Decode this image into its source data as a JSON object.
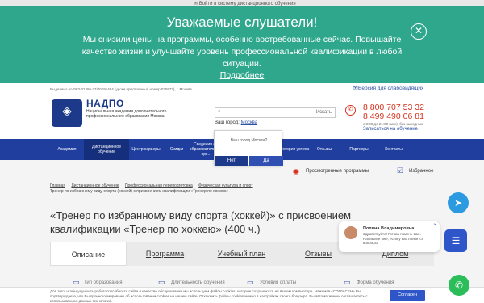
{
  "topbar": {
    "login_text": "✉ Войти в систему дистанционного обучения"
  },
  "banner": {
    "title": "Уважаемые слушатели!",
    "text": "Мы снизили цены на программы, особенно востребованные сейчас. Повышайте качество жизни и улучшайте уровень профессиональной квалификации в любой ситуации.",
    "more_link": "Подробнее",
    "close_icon": "✕"
  },
  "header": {
    "infoline": "Выделено по ЛКЗ-01286-77/00191484 (уроки присвоенный номер 035972), г. Москва",
    "vision_label": "Версия для слабовидящих",
    "logo_text": "◈",
    "brand": "НАДПО",
    "brand_sub": "Национальная академия дополнительного профессионального образования Москва",
    "search_button": "Искать",
    "city_label": "Ваш город:",
    "city_value": "Москва",
    "phone1": "8 800 707 53 32",
    "phone2": "8 499 490 06 81",
    "hours": "с 8:00 до 21:00 (мск), без выходных",
    "signup": "Записаться на обучение"
  },
  "nav": {
    "items": [
      "Академия",
      "Дистанционное обучение",
      "Центр карьеры",
      "Скидки",
      "Сведения об образовательной орг...",
      "",
      "",
      "История успеха",
      "Отзывы",
      "Партнеры",
      "Контакты"
    ]
  },
  "city_popup": {
    "question": "Ваш город Москва?",
    "no": "Нет",
    "yes": "Да"
  },
  "tools": {
    "viewed": "Просмотренные программы",
    "favorites": "Избранное"
  },
  "breadcrumbs": [
    "Главная",
    "Дистанционное обучение",
    "Профессиональная переподготовка",
    "Физическая культура и спорт",
    "Тренер по избранному виду спорта (хоккей) с присвоением квалификации «Тренер по хоккею»"
  ],
  "course": {
    "title": "«Тренер по избранному виду спорта (хоккей)» с присвоением квалификации «Тренер по хоккею» (400 ч.)"
  },
  "tabs": [
    "Описание",
    "Программа",
    "Учебный план",
    "Отзывы",
    "Диплом"
  ],
  "features": [
    "Тип образования",
    "Длительность обучения",
    "Условия оплаты",
    "Форма обучения"
  ],
  "cookie": {
    "text": "Для того, чтобы улучшить работоспособность сайта и качество обслуживания мы используем файлы cookies, которые сохраняются на вашем компьютере. Нажимая «СОГЛАСЕН» Вы подтверждаете, что Вы проинформированы об использовании cookies на нашем сайте. Отключить файлы cookies можно в настройках своего браузера. Вы автоматически соглашаетесь с использованием данных технологий.",
    "button": "Согласен"
  },
  "chat": {
    "name": "Полина Владимировна",
    "message": "Здравствуйте! Готова помочь вам. Напишите мне, если у вас появятся вопросы."
  }
}
